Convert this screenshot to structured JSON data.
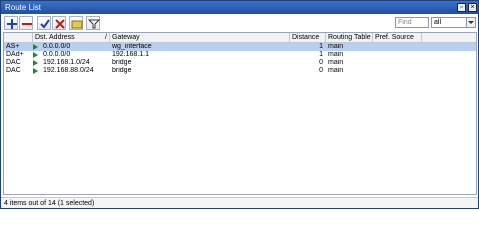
{
  "window": {
    "title": "Route List"
  },
  "toolbar": {
    "add_icon": "plus-icon",
    "remove_icon": "minus-icon",
    "enable_icon": "check-icon",
    "disable_icon": "cross-icon",
    "comment_icon": "note-icon",
    "filter_icon": "filter-icon",
    "find_placeholder": "Find",
    "filter_value": "all",
    "colors": {
      "add": "#1d3fbf",
      "remove": "#c51818",
      "enable": "#1d3fbf",
      "disable": "#c51818",
      "comment": "#e8c84a"
    }
  },
  "table": {
    "columns": [
      "",
      "Dst. Address",
      "Gateway",
      "Distance",
      "Routing Table",
      "Pref. Source"
    ],
    "rows": [
      {
        "flags": "AS+",
        "dst": "0.0.0.0/0",
        "gateway": "wg_interface",
        "distance": "1",
        "routing_table": "main",
        "pref_source": "",
        "selected": true
      },
      {
        "flags": "DAd+",
        "dst": "0.0.0.0/0",
        "gateway": "192.168.1.1",
        "distance": "1",
        "routing_table": "main",
        "pref_source": "",
        "selected": false
      },
      {
        "flags": "DAC",
        "dst": "192.168.1.0/24",
        "gateway": "bridge",
        "distance": "0",
        "routing_table": "main",
        "pref_source": "",
        "selected": false
      },
      {
        "flags": "DAC",
        "dst": "192.168.88.0/24",
        "gateway": "bridge",
        "distance": "0",
        "routing_table": "main",
        "pref_source": "",
        "selected": false
      }
    ],
    "selected_color": "#b7cff0"
  },
  "status": {
    "text": "4 items out of 14 (1 selected)"
  }
}
